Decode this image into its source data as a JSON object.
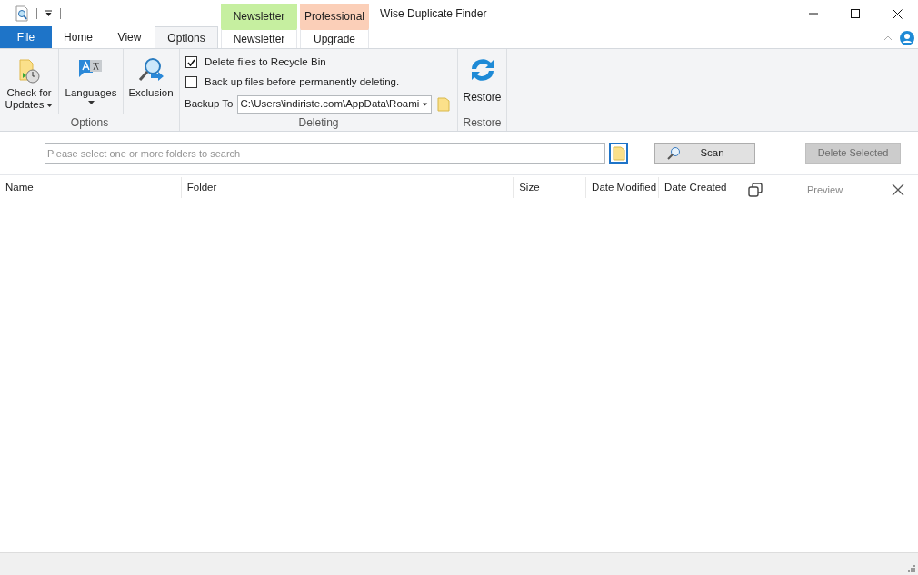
{
  "window": {
    "title": "Wise Duplicate Finder"
  },
  "tabs": [
    {
      "label": "File",
      "kind": "file",
      "selected": false
    },
    {
      "label": "Home",
      "kind": "normal",
      "selected": false
    },
    {
      "label": "View",
      "kind": "normal",
      "selected": false
    },
    {
      "label": "Options",
      "kind": "normal",
      "selected": true
    },
    {
      "label": "Newsletter",
      "kind": "context",
      "context_label": "Newsletter",
      "color": "#c6efa0",
      "selected": false
    },
    {
      "label": "Upgrade",
      "kind": "context",
      "context_label": "Professional",
      "color": "#fbcfb8",
      "selected": false
    }
  ],
  "ribbon": {
    "options_group": {
      "label": "Options",
      "buttons": [
        {
          "label": "Check for Updates",
          "kind": "updates",
          "has_dropdown": true
        },
        {
          "label": "Languages",
          "kind": "languages",
          "has_dropdown": true
        },
        {
          "label": "Exclusion",
          "kind": "exclusion",
          "has_dropdown": false
        }
      ]
    },
    "deleting_group": {
      "label": "Deleting",
      "checkboxes": [
        {
          "label": "Delete files to Recycle Bin",
          "checked": true
        },
        {
          "label": "Back up files before permanently deleting.",
          "checked": false
        }
      ],
      "backup_label": "Backup To",
      "backup_path": "C:\\Users\\indiriste.com\\AppData\\Roami"
    },
    "restore_group": {
      "label": "Restore",
      "button": "Restore"
    }
  },
  "search": {
    "placeholder": "Please select one or more folders to search",
    "scan": "Scan",
    "delete_selected": "Delete Selected",
    "delete_disabled": true
  },
  "table": {
    "columns": [
      "Name",
      "Folder",
      "Size",
      "Date Modified",
      "Date Created"
    ]
  },
  "preview": {
    "label": "Preview"
  }
}
